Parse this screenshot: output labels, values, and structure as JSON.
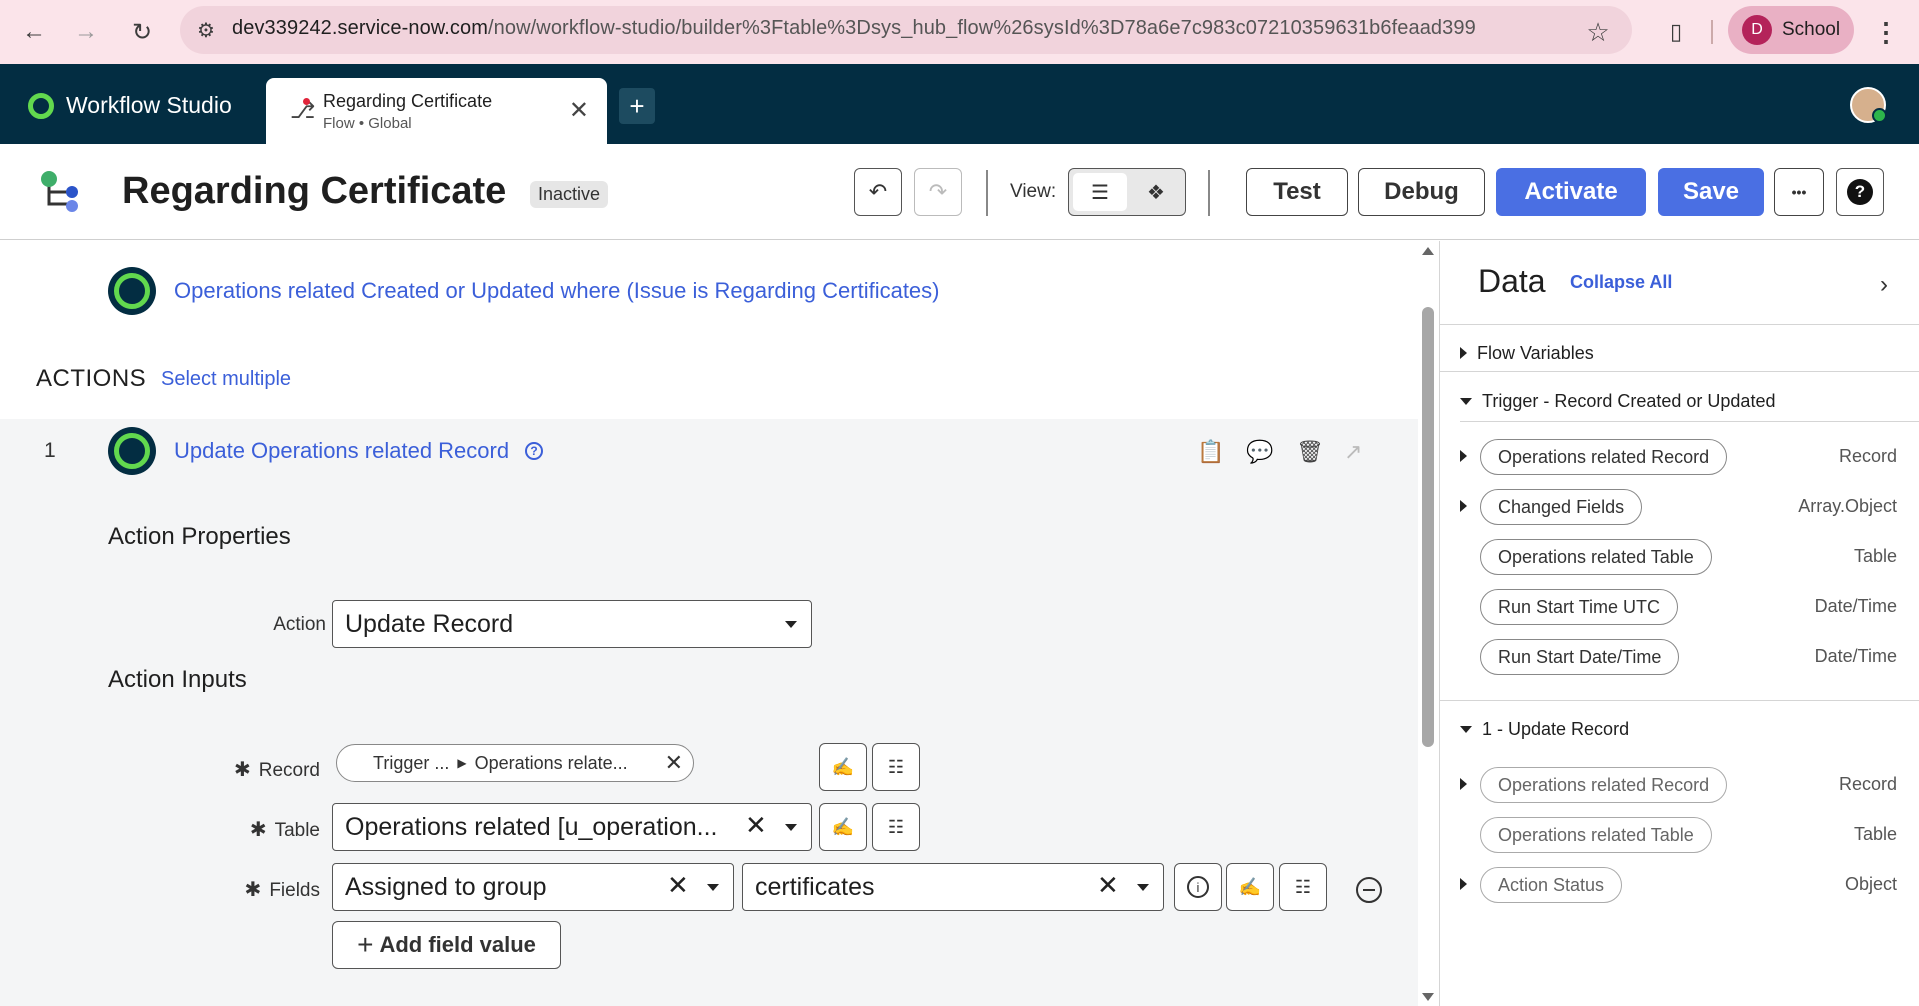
{
  "browser": {
    "url_host": "dev339242.service-now.com",
    "url_path": "/now/workflow-studio/builder%3Ftable%3Dsys_hub_flow%26sysId%3D78a6e7c983c07210359631b6feaad399",
    "profile_initial": "D",
    "profile_label": "School"
  },
  "app": {
    "brand": "Workflow Studio",
    "tab_title": "Regarding Certificate",
    "tab_subtitle": "Flow • Global"
  },
  "toolbar": {
    "flow_title": "Regarding Certificate",
    "status": "Inactive",
    "view_label": "View:",
    "test_label": "Test",
    "debug_label": "Debug",
    "activate_label": "Activate",
    "save_label": "Save",
    "more_label": "•••",
    "help_label": "?"
  },
  "trigger": {
    "text": "Operations related Created or Updated where (Issue is Regarding Certificates)"
  },
  "actions": {
    "heading": "ACTIONS",
    "select_multiple": "Select multiple",
    "items": [
      {
        "number": "1",
        "title": "Update Operations related Record"
      }
    ],
    "properties_title": "Action Properties",
    "action_label": "Action",
    "action_value": "Update Record",
    "inputs_title": "Action Inputs",
    "record_label": "Record",
    "record_pill_part1": "Trigger ...",
    "record_pill_part2": "Operations relate...",
    "table_label": "Table",
    "table_value": "Operations related [u_operation...",
    "fields_label": "Fields",
    "field_name": "Assigned to group",
    "field_value": "certificates",
    "add_field_label": "Add field value"
  },
  "data_panel": {
    "title": "Data",
    "collapse_all": "Collapse All",
    "groups": [
      {
        "label": "Flow Variables",
        "expanded": false,
        "items": []
      },
      {
        "label": "Trigger - Record Created or Updated",
        "expanded": true,
        "items": [
          {
            "name": "Operations related Record",
            "type": "Record",
            "expandable": true
          },
          {
            "name": "Changed Fields",
            "type": "Array.Object",
            "expandable": true
          },
          {
            "name": "Operations related Table",
            "type": "Table",
            "expandable": false
          },
          {
            "name": "Run Start Time UTC",
            "type": "Date/Time",
            "expandable": false
          },
          {
            "name": "Run Start Date/Time",
            "type": "Date/Time",
            "expandable": false
          }
        ]
      },
      {
        "label": "1 - Update Record",
        "expanded": true,
        "items": [
          {
            "name": "Operations related Record",
            "type": "Record",
            "expandable": true
          },
          {
            "name": "Operations related Table",
            "type": "Table",
            "expandable": false
          },
          {
            "name": "Action Status",
            "type": "Object",
            "expandable": true
          }
        ]
      }
    ]
  },
  "colors": {
    "brand_navy": "#032d42",
    "accent_green": "#62d84e",
    "primary_blue": "#4a6fe3",
    "link_blue": "#3b5fd9"
  }
}
